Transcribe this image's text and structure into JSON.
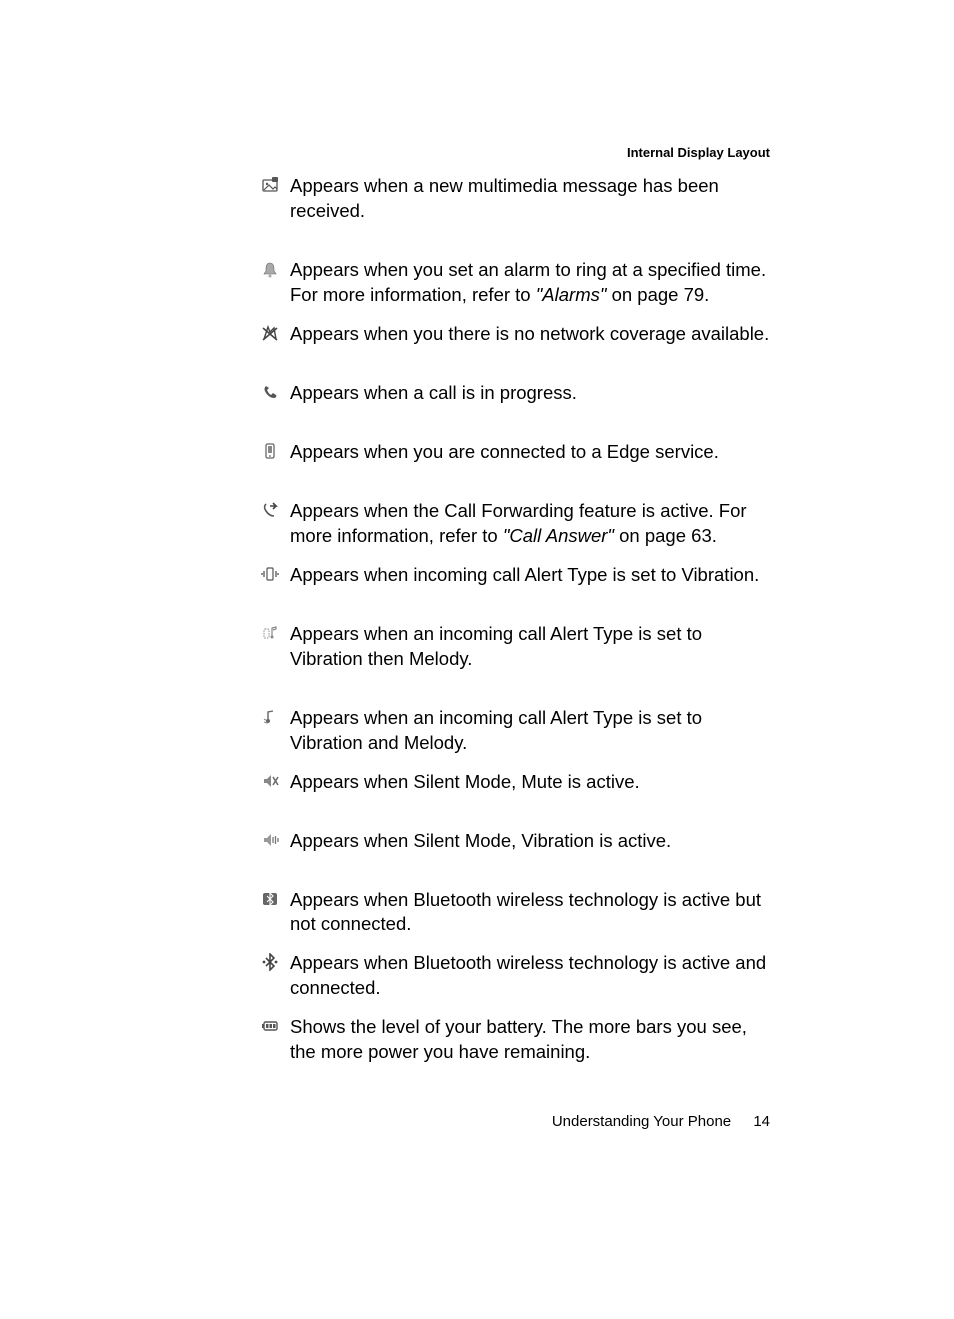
{
  "header": "Internal Display Layout",
  "rows": [
    {
      "icon": "mms-icon",
      "text_parts": [
        {
          "t": "Appears when a new multimedia message has been received."
        }
      ]
    },
    {
      "icon": "alarm-icon",
      "text_parts": [
        {
          "t": "Appears when you set an alarm to ring at a specified time. For more information, refer to "
        },
        {
          "t": "\"Alarms\" ",
          "ital": true
        },
        {
          "t": " on page 79."
        }
      ]
    },
    {
      "icon": "no-network-icon",
      "text_parts": [
        {
          "t": "Appears when you there is no network coverage available."
        }
      ]
    },
    {
      "icon": "call-icon",
      "text_parts": [
        {
          "t": "Appears when a call is in progress."
        }
      ]
    },
    {
      "icon": "edge-icon",
      "text_parts": [
        {
          "t": "Appears when you are connected to a Edge service."
        }
      ]
    },
    {
      "icon": "call-forward-icon",
      "text_parts": [
        {
          "t": "Appears when the Call Forwarding feature is active. For more information, refer to "
        },
        {
          "t": "\"Call Answer\" ",
          "ital": true
        },
        {
          "t": " on page 63."
        }
      ]
    },
    {
      "icon": "vibration-icon",
      "text_parts": [
        {
          "t": "Appears when incoming call Alert Type is set to Vibration."
        }
      ]
    },
    {
      "icon": "vib-then-melody-icon",
      "text_parts": [
        {
          "t": "Appears when an incoming call Alert Type is set to Vibration then Melody."
        }
      ]
    },
    {
      "icon": "vib-and-melody-icon",
      "text_parts": [
        {
          "t": "Appears when an incoming call Alert Type is set to Vibration and Melody."
        }
      ]
    },
    {
      "icon": "mute-icon",
      "text_parts": [
        {
          "t": "Appears when Silent Mode, Mute is active."
        }
      ]
    },
    {
      "icon": "silent-vib-icon",
      "text_parts": [
        {
          "t": "Appears when Silent Mode, Vibration is active."
        }
      ]
    },
    {
      "icon": "bluetooth-icon",
      "text_parts": [
        {
          "t": "Appears when Bluetooth wireless technology is active but not connected."
        }
      ]
    },
    {
      "icon": "bluetooth-connected-icon",
      "text_parts": [
        {
          "t": "Appears when Bluetooth wireless technology is active and connected."
        }
      ]
    },
    {
      "icon": "battery-icon",
      "text_parts": [
        {
          "t": "Shows the level of your battery. The more bars you see, the more power you have remaining."
        }
      ]
    }
  ],
  "footer": {
    "section": "Understanding Your Phone",
    "page": "14"
  },
  "tight_after": [
    1,
    5,
    8,
    11,
    12
  ]
}
